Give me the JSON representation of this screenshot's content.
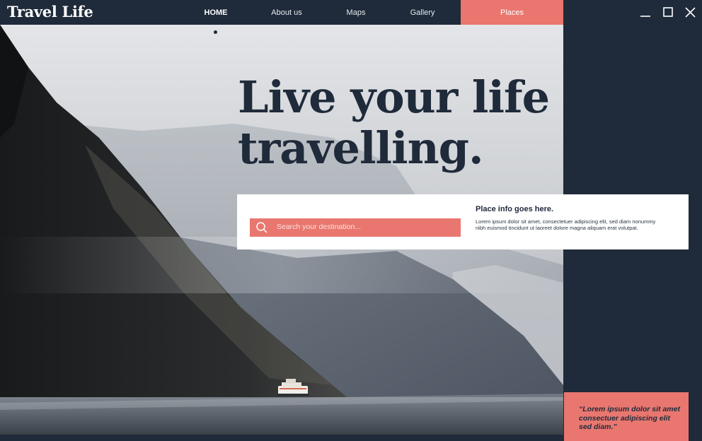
{
  "app": {
    "logo": "Travel Life"
  },
  "nav": {
    "home": "HOME",
    "about": "About us",
    "maps": "Maps",
    "gallery": "Gallery",
    "places": "Places"
  },
  "window_controls": [
    "minimize-icon",
    "maximize-icon",
    "close-icon"
  ],
  "hero": {
    "headline_line1": "Live your life",
    "headline_line2": "travelling."
  },
  "search": {
    "placeholder": "Search your destination...",
    "icon": "search-icon"
  },
  "info": {
    "title": "Place info goes here.",
    "body": "Lorem ipsum dolor sit amet, consectetuer adipiscing elit, sed diam nonummy nibh euismod tincidunt ut laoreet dolore magna aliquam erat volutpat."
  },
  "quote": {
    "text": "“Lorem ipsum dolor sit amet consectuer adipiscing elit sed diam.”"
  },
  "colors": {
    "navy": "#1f2a3a",
    "coral": "#e9776f",
    "white": "#ffffff"
  }
}
